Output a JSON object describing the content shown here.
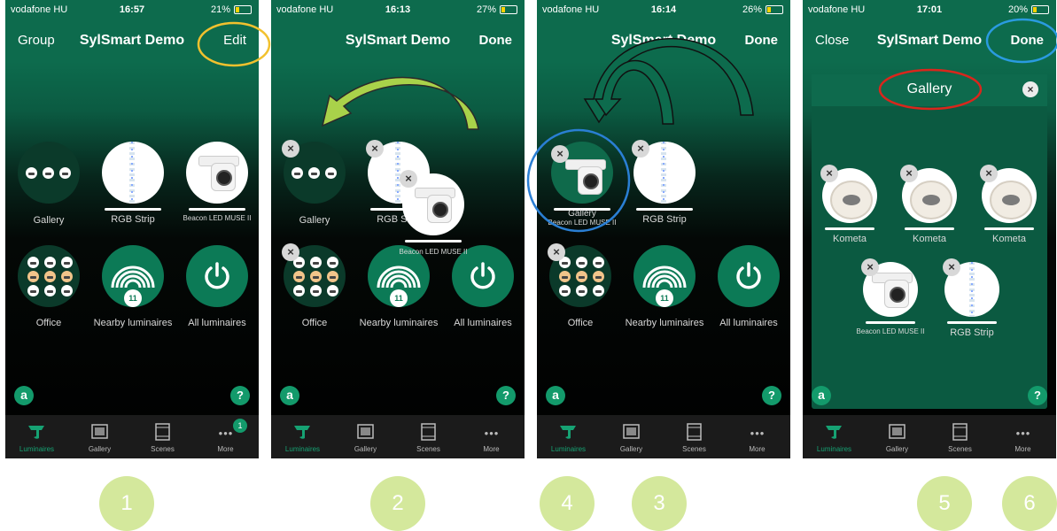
{
  "status": {
    "carrier": "vodafone HU",
    "phones": [
      {
        "time": "16:57",
        "battery": "21%"
      },
      {
        "time": "16:13",
        "battery": "27%"
      },
      {
        "time": "16:14",
        "battery": "26%"
      },
      {
        "time": "17:01",
        "battery": "20%"
      }
    ]
  },
  "nav": {
    "title": "SylSmart Demo",
    "p1_left": "Group",
    "p1_right": "Edit",
    "done": "Done",
    "close": "Close"
  },
  "tiles": {
    "gallery": "Gallery",
    "rgb_strip": "RGB Strip",
    "beacon": "Beacon LED MUSE II",
    "office": "Office",
    "nearby": "Nearby luminaires",
    "nearby_count": "11",
    "all": "All luminaires",
    "kometa": "Kometa",
    "remove": "×",
    "drag_label": "Gallery"
  },
  "gallery_panel": {
    "title": "Gallery",
    "close": "×"
  },
  "helpers": {
    "assistant": "a",
    "help": "?"
  },
  "tabs": [
    {
      "label": "Luminaires"
    },
    {
      "label": "Gallery"
    },
    {
      "label": "Scenes"
    },
    {
      "label": "More"
    }
  ],
  "more_badge": "1",
  "more_dots": "•••",
  "steps": [
    "1",
    "2",
    "4",
    "3",
    "5",
    "6"
  ],
  "colors": {
    "accent_green": "#16a273",
    "step_circle": "#d4e89c",
    "arrow_green": "#a9d24a",
    "highlight_yellow": "#f2c12e",
    "highlight_blue": "#2a7fd4",
    "highlight_red": "#d9261c"
  }
}
